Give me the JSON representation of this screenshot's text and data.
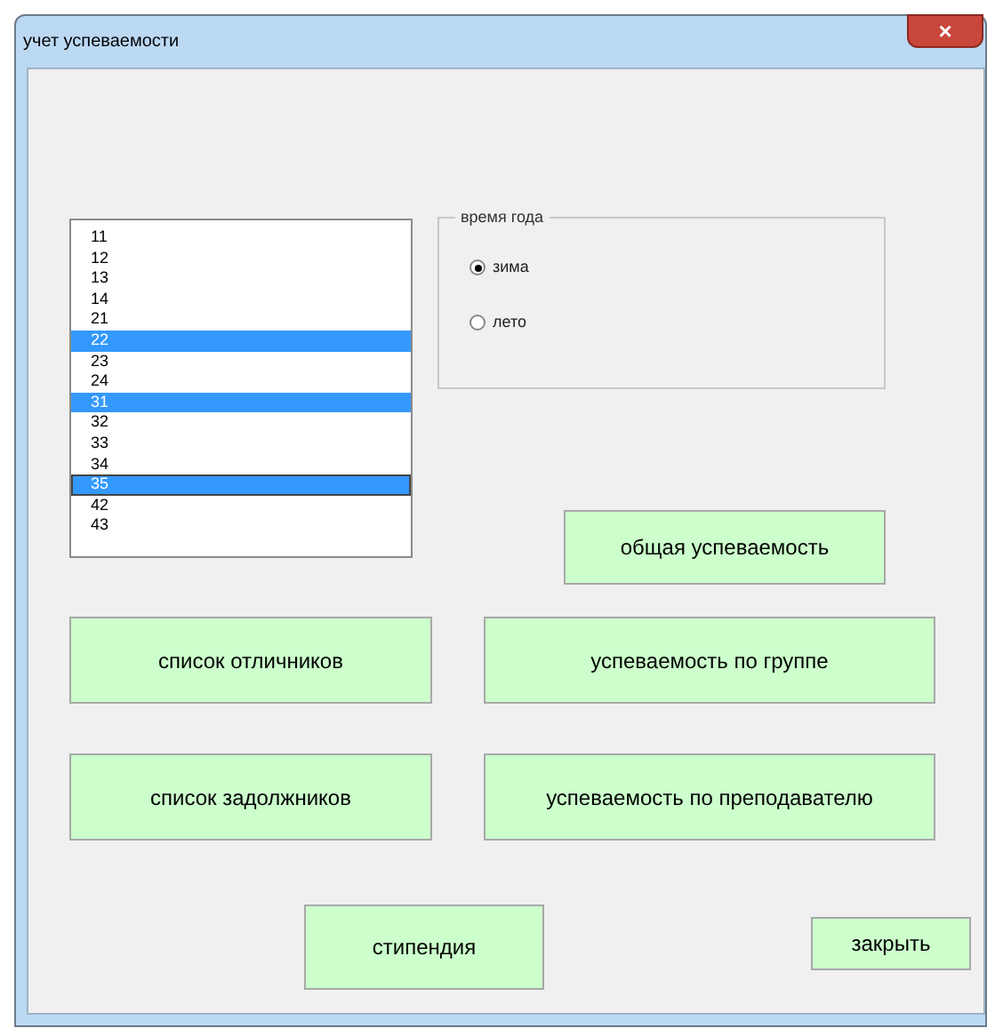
{
  "window": {
    "title": "учет успеваемости",
    "close": "×"
  },
  "listbox": {
    "items": [
      {
        "label": "11",
        "selected": false,
        "focused": false
      },
      {
        "label": "12",
        "selected": false,
        "focused": false
      },
      {
        "label": "13",
        "selected": false,
        "focused": false
      },
      {
        "label": "14",
        "selected": false,
        "focused": false
      },
      {
        "label": "21",
        "selected": false,
        "focused": false
      },
      {
        "label": "22",
        "selected": true,
        "focused": false
      },
      {
        "label": "23",
        "selected": false,
        "focused": false
      },
      {
        "label": "24",
        "selected": false,
        "focused": false
      },
      {
        "label": "31",
        "selected": true,
        "focused": false
      },
      {
        "label": "32",
        "selected": false,
        "focused": false
      },
      {
        "label": "33",
        "selected": false,
        "focused": false
      },
      {
        "label": "34",
        "selected": false,
        "focused": false
      },
      {
        "label": "35",
        "selected": true,
        "focused": true
      },
      {
        "label": "42",
        "selected": false,
        "focused": false
      },
      {
        "label": "43",
        "selected": false,
        "focused": false
      }
    ]
  },
  "season": {
    "legend": "время года",
    "options": [
      {
        "label": "зима",
        "selected": true
      },
      {
        "label": "лето",
        "selected": false
      }
    ]
  },
  "buttons": [
    {
      "label": "общая успеваемость"
    },
    {
      "label": "список отличников"
    },
    {
      "label": "успеваемость по группе"
    },
    {
      "label": "список задолжников"
    },
    {
      "label": "успеваемость по преподавателю"
    },
    {
      "label": "стипендия"
    },
    {
      "label": "закрыть"
    }
  ]
}
